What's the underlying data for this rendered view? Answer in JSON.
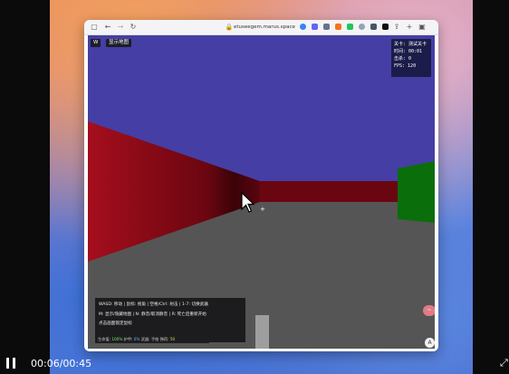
{
  "browser": {
    "url": "etuseegem.marus.space",
    "nav_back": "←",
    "nav_forward": "→",
    "nav_reload": "↻"
  },
  "game": {
    "toggle_label": "W",
    "show_map_button": "显示地图",
    "hud": {
      "level": "关卡: 测试关卡",
      "time": "时间: 00:01",
      "score": "击杀: 0",
      "fps": "FPS: 120"
    },
    "controls_lines": [
      "WASD: 移动 | 鼠标: 视角 | 空格/Ctrl: 射击 | 1-7: 切换武器",
      "M: 显示/隐藏地图 | N: 静音/取消静音 | R: 死亡后重新开始",
      "点击画面锁定鼠标"
    ],
    "status": {
      "health_label": "生命值:",
      "health_value": "100%",
      "armor_label": "护甲:",
      "armor_value": "0%",
      "weapon_label": "武器:",
      "weapon_value": "手枪",
      "ammo_label": "弹药:",
      "ammo_value": "50"
    },
    "crosshair": "+",
    "corner_button": "A",
    "badge": "~"
  },
  "player": {
    "time": "00:06/00:45"
  },
  "colors": {
    "sky": "#453ea5",
    "floor": "#555555",
    "wall_red": "#9b0d1c",
    "wall_green": "#0a6e0a"
  }
}
